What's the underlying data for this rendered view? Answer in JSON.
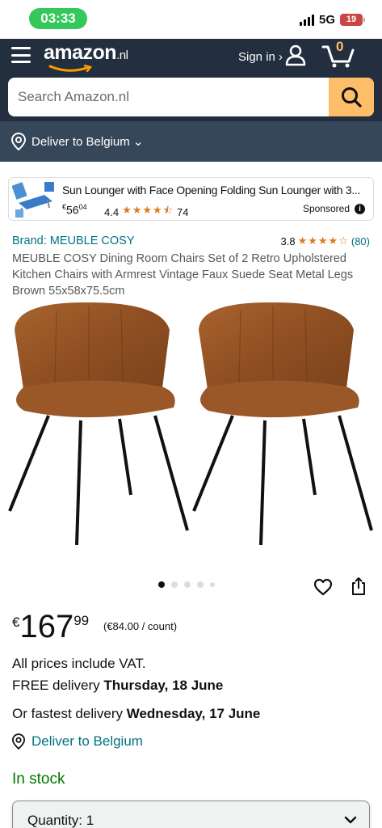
{
  "status": {
    "time": "03:33",
    "network": "5G",
    "battery": "19"
  },
  "header": {
    "logo_text": "amazon",
    "logo_tld": ".nl",
    "signin_label": "Sign in ›",
    "cart_count": "0",
    "search_placeholder": "Search Amazon.nl",
    "deliver_label": "Deliver to Belgium ⌄"
  },
  "sponsored": {
    "title": "Sun Lounger with Face Opening Folding Sun Lounger with 3...",
    "price_currency": "€",
    "price_whole": "56",
    "price_fraction": "04",
    "rating": "4.4",
    "stars": "★★★★⯪",
    "review_count": "74",
    "sponsored_label": "Sponsored",
    "info_glyph": "i"
  },
  "product": {
    "brand": "Brand: MEUBLE COSY",
    "rating": "3.8",
    "stars": "★★★★☆",
    "review_count": "(80)",
    "title": "MEUBLE COSY Dining Room Chairs Set of 2 Retro Upholstered Kitchen Chairs with Armrest Vintage Faux Suede Seat Metal Legs Brown 55x58x75.5cm",
    "image_count": 5,
    "active_image": 1
  },
  "pricing": {
    "currency": "€",
    "whole": "167",
    "fraction": "99",
    "unit_price": "(€84.00 / count)",
    "vat_note": "All prices include VAT."
  },
  "delivery": {
    "free_prefix": "FREE delivery ",
    "free_date": "Thursday, 18 June",
    "fastest_prefix": "Or fastest delivery ",
    "fastest_date": "Wednesday, 17 June",
    "deliver_to": "Deliver to Belgium"
  },
  "availability": {
    "stock": "In stock",
    "quantity_label": "Quantity: 1"
  },
  "colors": {
    "header_bg": "#232f3e",
    "subheader_bg": "#37475a",
    "accent": "#febd69",
    "link": "#007185",
    "in_stock": "#007600",
    "star": "#de7921"
  }
}
